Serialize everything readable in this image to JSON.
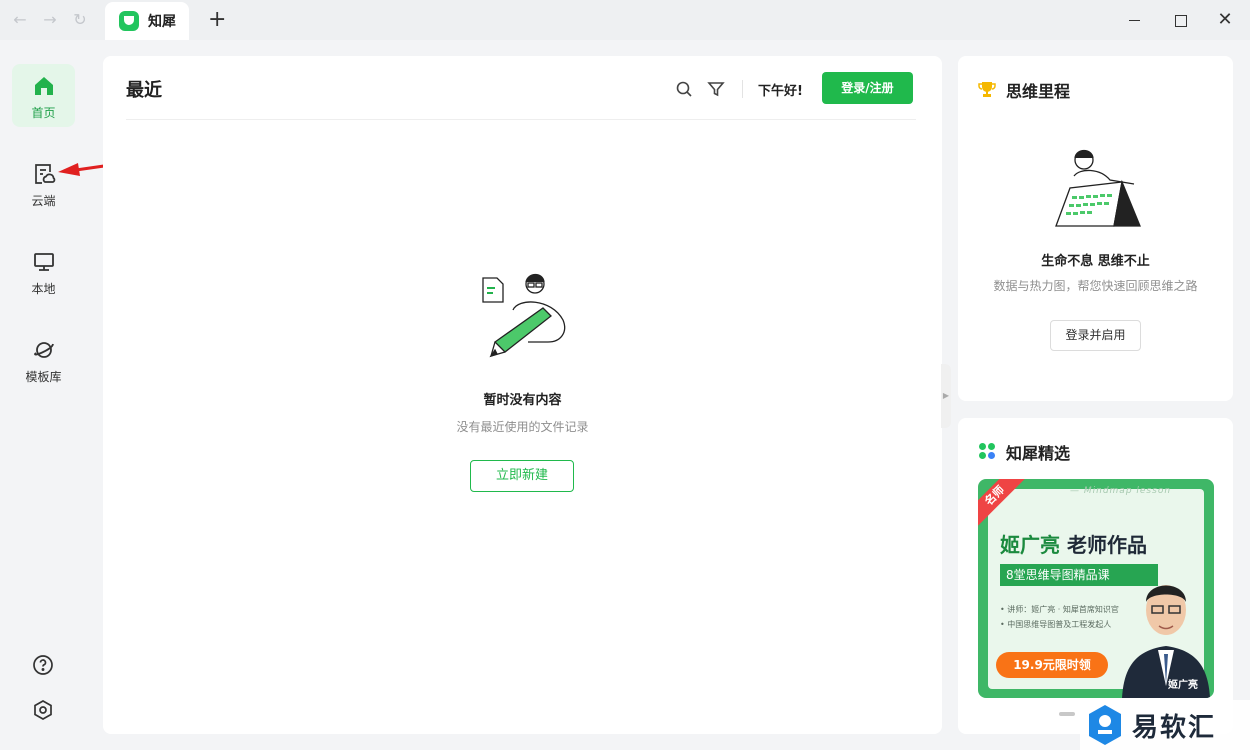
{
  "window": {
    "tab_title": "知犀",
    "new_tab_symbol": "+",
    "close_symbol": "✕"
  },
  "sidebar": {
    "items": [
      {
        "label": "首页",
        "icon": "home-icon",
        "active": true
      },
      {
        "label": "云端",
        "icon": "cloud-file-icon",
        "active": false
      },
      {
        "label": "本地",
        "icon": "monitor-icon",
        "active": false
      },
      {
        "label": "模板库",
        "icon": "planet-icon",
        "active": false
      }
    ],
    "bottom_icons": [
      "help-icon",
      "settings-icon"
    ]
  },
  "main": {
    "title": "最近",
    "greeting": "下午好!",
    "login_label": "登录/注册",
    "empty_title": "暂时没有内容",
    "empty_subtitle": "没有最近使用的文件记录",
    "new_button": "立即新建"
  },
  "card_milestone": {
    "title": "思维里程",
    "heading": "生命不息 思维不止",
    "subtitle": "数据与热力图，帮您快速回顾思维之路",
    "button": "登录并启用"
  },
  "card_featured": {
    "title": "知犀精选",
    "banner": {
      "ribbon": "名师",
      "tagline": "— Mindmap lesson",
      "headline_name": "姬广亮",
      "headline_rest": " 老师作品",
      "subtitle": "8堂思维导图精品课",
      "line1": "• 讲师：姬广亮 · 知犀首席知识官",
      "line2": "• 中国思维导图普及工程发起人",
      "price": "19.9元限时领",
      "teacher_name": "姬广亮"
    }
  },
  "watermark": {
    "text": "易软汇"
  },
  "colors": {
    "accent": "#20b94c",
    "accent_light": "#e4f6e9",
    "annotation": "#e02020",
    "orange": "#f97316"
  }
}
